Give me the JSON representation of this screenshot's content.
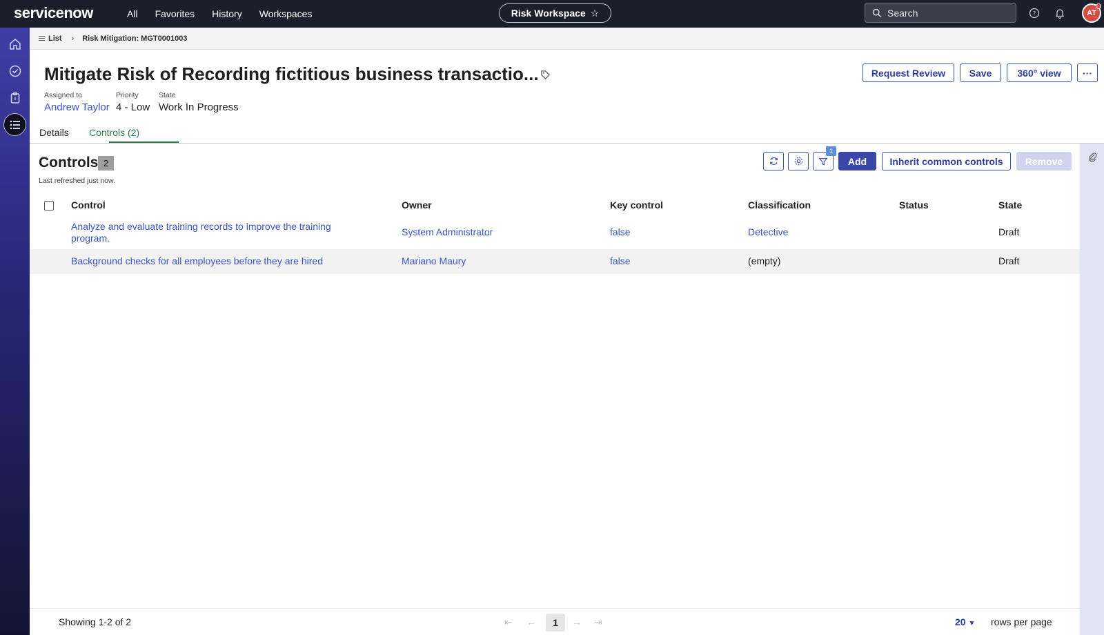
{
  "topbar": {
    "logo": "servicenow",
    "nav": [
      "All",
      "Favorites",
      "History",
      "Workspaces"
    ],
    "workspace": "Risk Workspace",
    "search_placeholder": "Search",
    "avatar_initials": "AT"
  },
  "rail": {
    "items": [
      "home-icon",
      "check-circle-icon",
      "clipboard-icon",
      "list-icon"
    ],
    "active": "list-icon"
  },
  "breadcrumb": {
    "list": "List",
    "current": "Risk Mitigation: MGT0001003"
  },
  "record": {
    "title": "Mitigate Risk of Recording fictitious business transactio...",
    "assigned_to_label": "Assigned to",
    "assigned_to": "Andrew Taylor",
    "priority_label": "Priority",
    "priority": "4 - Low",
    "state_label": "State",
    "state": "Work In Progress"
  },
  "actions": {
    "request_review": "Request Review",
    "save": "Save",
    "view360": "360° view",
    "more": "···"
  },
  "tabs": [
    {
      "label": "Details"
    },
    {
      "label": "Controls (2)"
    }
  ],
  "active_tab": "Controls (2)",
  "controls": {
    "title": "Controls",
    "count": "2",
    "refreshed": "Last refreshed just now.",
    "filter_count": "1",
    "add": "Add",
    "inherit": "Inherit common controls",
    "remove": "Remove"
  },
  "table": {
    "headers": [
      "Control",
      "Owner",
      "Key control",
      "Classification",
      "Status",
      "State"
    ],
    "rows": [
      {
        "control": "Analyze and evaluate training records to improve the training program.",
        "owner": "System Administrator",
        "key_control": "false",
        "classification": "Detective",
        "status": "",
        "state": "Draft"
      },
      {
        "control": "Background checks for all employees before they are hired",
        "owner": "Mariano Maury",
        "key_control": "false",
        "classification": "(empty)",
        "status": "",
        "state": "Draft"
      }
    ]
  },
  "footer": {
    "showing": "Showing 1-2 of 2",
    "page": "1",
    "rows_per_page": "20",
    "rows_label": "rows per page"
  },
  "colors": {
    "topbar": "#1b1e2b",
    "link": "#3a55c7",
    "primary": "#3b47a8",
    "tab_active": "#2a7a4b"
  }
}
